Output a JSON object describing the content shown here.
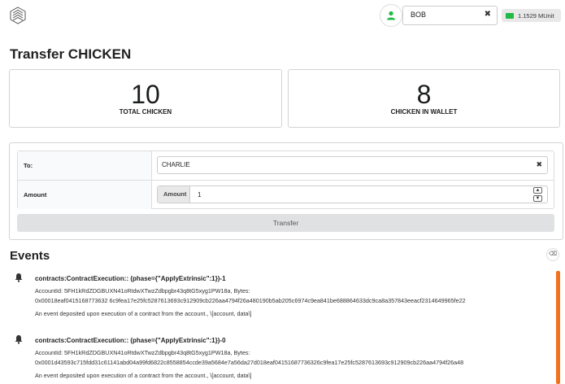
{
  "header": {
    "account": "BOB",
    "clear_symbol": "✖",
    "balance": "1.1529 MUnit",
    "colors": {
      "balance_badge": "#21ba45",
      "account_icon": "#21ba45"
    }
  },
  "page_title": "Transfer CHICKEN",
  "stats": [
    {
      "value": "10",
      "label": "TOTAL CHICKEN"
    },
    {
      "value": "8",
      "label": "CHICKEN IN WALLET"
    }
  ],
  "form": {
    "to_label": "To:",
    "to_value": "CHARLIE",
    "amount_label": "Amount",
    "amount_inner_label": "Amount",
    "amount_value": "1",
    "transfer_label": "Transfer"
  },
  "events": {
    "title": "Events",
    "items": [
      {
        "title": "contracts:ContractExecution:: (phase={\"ApplyExtrinsic\":1})-1",
        "line1": "AccountId: 5FH1kRdZDGBUXN41oRtdwXTwzZdbpgbr43q8tG5xyg1PW18a, Bytes:",
        "line2": "0x00018eaf0415168773632 6c9fea17e25fc5287613693c912909cb226aa4794f26a480190b5ab205c6974c9ea841be688864633dc9ca8a357843eeacf2314649965fe22",
        "doc": "An event deposited upon execution of a contract from the account., \\[account, data\\]"
      },
      {
        "title": "contracts:ContractExecution:: (phase={\"ApplyExtrinsic\":1})-0",
        "line1": "AccountId: 5FH1kRdZDGBUXN41oRtdwXTwzZdbpgbr43q8tG5xyg1PW18a, Bytes:",
        "line2": "0x0001d43593c715fdd31c61141abd04a99fd6822c8558854ccde39a5684e7a56da27d018eaf04151687736326c9fea17e25fc5287613693c912909cb226aa4794f26a48",
        "doc": "An event deposited upon execution of a contract from the account., \\[account, data\\]"
      }
    ],
    "colors": {
      "scrollbar": "#f2711c"
    }
  }
}
